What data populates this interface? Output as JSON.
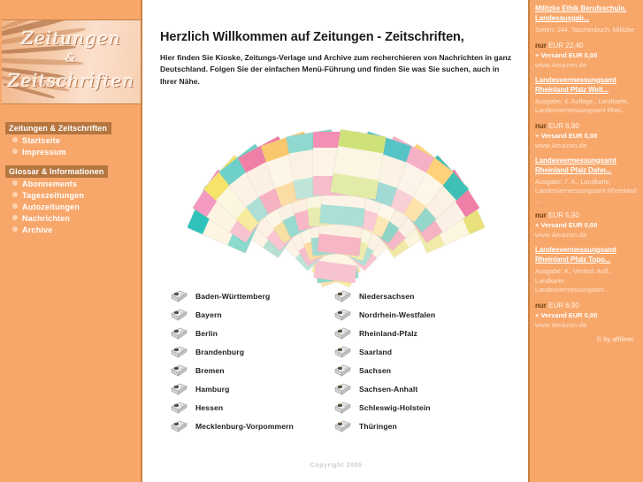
{
  "logo": {
    "line1": "Zeitungen",
    "line2": "&",
    "line3": "Zeitschriften"
  },
  "sidebar": {
    "sections": [
      {
        "heading": "Zeitungen & Zeitschriften",
        "items": [
          {
            "label": "Startseite"
          },
          {
            "label": "Impressum"
          }
        ]
      },
      {
        "heading": "Glossar & Informationen",
        "items": [
          {
            "label": "Abonnements"
          },
          {
            "label": "Tageszeitungen"
          },
          {
            "label": "Autozeitungen"
          },
          {
            "label": "Nachrichten"
          },
          {
            "label": "Archive"
          }
        ]
      }
    ]
  },
  "main": {
    "title": "Herzlich Willkommen auf Zeitungen - Zeitschriften,",
    "intro": "Hier finden Sie Kioske, Zeitungs-Verlage und Archive zum recherchieren von Nachrichten in ganz Deutschland. Folgen Sie der einfachen Menü-Führung und finden Sie was Sie suchen, auch in Ihrer Nähe.",
    "collage_alt": "magazine-collage",
    "states_left": [
      "Baden-Württemberg",
      "Bayern",
      "Berlin",
      "Brandenburg",
      "Bremen",
      "Hamburg",
      "Hessen",
      "Mecklenburg-Vorpommern"
    ],
    "states_right": [
      "Niedersachsen",
      "Nordrhein-Westfalen",
      "Rheinland-Pfalz",
      "Saarland",
      "Sachsen",
      "Sachsen-Anhalt",
      "Schleswig-Holstein",
      "Thüringen"
    ],
    "copyright": "Copyright 2006"
  },
  "ads": {
    "items": [
      {
        "title": "Militzke Ethik Berufsschule, Landesausgab...",
        "desc": "Seiten: 244, Taschenbuch, Militzke",
        "price_prefix": "nur",
        "price": "EUR 22,40",
        "shipping": "+ Versand EUR 0,00",
        "source": "www.Amazon.de"
      },
      {
        "title": "Landesvermessungsamt Rheinland Pfalz Welt...",
        "desc": "Ausgabe: 4. Auflage., Landkarte, Landesvermessungsamt Rhei...",
        "price_prefix": "nur",
        "price": "EUR 6,90",
        "shipping": "+ Versand EUR 0,00",
        "source": "www.Amazon.de"
      },
      {
        "title": "Landesvermessungsamt Rheinland Pfalz Dahn...",
        "desc": "Ausgabe: 7. A., Landkarte, Landesvermessungsamt Rheinland ...",
        "price_prefix": "nur",
        "price": "EUR 5,90",
        "shipping": "+ Versand EUR 0,00",
        "source": "www.Amazon.de"
      },
      {
        "title": "Landesvermessungsamt Rheinland Pfalz Topo...",
        "desc": "Ausgabe: 4., Veränd. Aufl., Landkarte, Landesvermessungsam...",
        "price_prefix": "nur",
        "price": "EUR 6,90",
        "shipping": "+ Versand EUR 0,00",
        "source": "www.Amazon.de"
      }
    ],
    "affiliate": "© by affilinet"
  },
  "colors": {
    "sidebar_orange": "#f8a76b",
    "sidebar_border": "#c98243",
    "nav_heading_bg": "#b5763f",
    "bullet": "#fcd3ae",
    "text_dark": "#1c1c1c",
    "copyright_gray": "#cfcfcf"
  }
}
